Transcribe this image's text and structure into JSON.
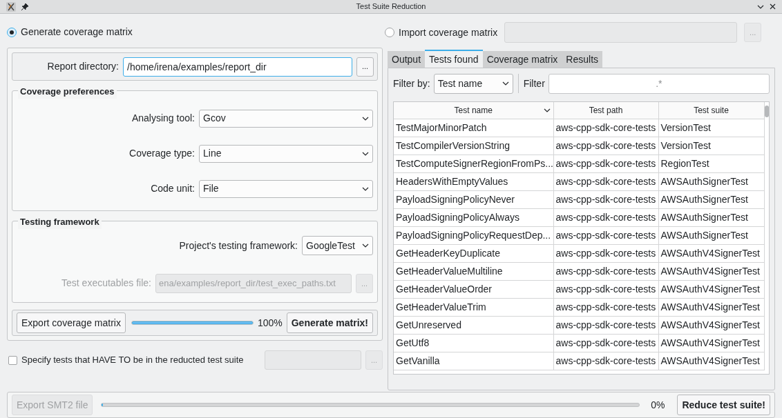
{
  "window": {
    "title": "Test Suite Reduction"
  },
  "source_options": [
    {
      "label": "Generate coverage matrix",
      "selected": true
    },
    {
      "label": "Import coverage matrix",
      "selected": false
    }
  ],
  "import_path": {
    "disabled": true,
    "browse": "..."
  },
  "report_directory": {
    "label": "Report directory:",
    "value": "/home/irena/examples/report_dir",
    "browse": "..."
  },
  "coverage_preferences": {
    "title": "Coverage preferences",
    "fields": [
      {
        "label": "Analysing tool:",
        "value": "Gcov"
      },
      {
        "label": "Coverage type:",
        "value": "Line"
      },
      {
        "label": "Code unit:",
        "value": "File"
      }
    ]
  },
  "testing_framework": {
    "title": "Testing framework",
    "framework": {
      "label": "Project's testing framework:",
      "value": "GoogleTest"
    },
    "executables": {
      "label": "Test executables file:",
      "value": "ena/examples/report_dir/test_exec_paths.txt",
      "browse": "...",
      "disabled": true
    }
  },
  "matrix_bar": {
    "export": "Export coverage matrix",
    "level": 1,
    "reading": "100%",
    "generate": "Generate matrix!"
  },
  "required_tests": {
    "label": "Specify tests that HAVE TO be in the reducted test suite",
    "checked": false,
    "browse": "..."
  },
  "tabs": [
    {
      "label": "Output",
      "selected": false
    },
    {
      "label": "Tests found",
      "selected": true
    },
    {
      "label": "Coverage matrix",
      "selected": false
    },
    {
      "label": "Results",
      "selected": false
    }
  ],
  "filter": {
    "by_label": "Filter by:",
    "by_value": "Test name",
    "label": "Filter",
    "placeholder": ".*"
  },
  "table": {
    "columns": [
      "Test name",
      "Test path",
      "Test suite"
    ],
    "rows": [
      [
        "TestMajorMinorPatch",
        "aws-cpp-sdk-core-tests",
        "VersionTest"
      ],
      [
        "TestCompilerVersionString",
        "aws-cpp-sdk-core-tests",
        "VersionTest"
      ],
      [
        "TestComputeSignerRegionFromPs...",
        "aws-cpp-sdk-core-tests",
        "RegionTest"
      ],
      [
        "HeadersWithEmptyValues",
        "aws-cpp-sdk-core-tests",
        "AWSAuthSignerTest"
      ],
      [
        "PayloadSigningPolicyNever",
        "aws-cpp-sdk-core-tests",
        "AWSAuthSignerTest"
      ],
      [
        "PayloadSigningPolicyAlways",
        "aws-cpp-sdk-core-tests",
        "AWSAuthSignerTest"
      ],
      [
        "PayloadSigningPolicyRequestDep...",
        "aws-cpp-sdk-core-tests",
        "AWSAuthSignerTest"
      ],
      [
        "GetHeaderKeyDuplicate",
        "aws-cpp-sdk-core-tests",
        "AWSAuthV4SignerTest"
      ],
      [
        "GetHeaderValueMultiline",
        "aws-cpp-sdk-core-tests",
        "AWSAuthV4SignerTest"
      ],
      [
        "GetHeaderValueOrder",
        "aws-cpp-sdk-core-tests",
        "AWSAuthV4SignerTest"
      ],
      [
        "GetHeaderValueTrim",
        "aws-cpp-sdk-core-tests",
        "AWSAuthV4SignerTest"
      ],
      [
        "GetUnreserved",
        "aws-cpp-sdk-core-tests",
        "AWSAuthV4SignerTest"
      ],
      [
        "GetUtf8",
        "aws-cpp-sdk-core-tests",
        "AWSAuthV4SignerTest"
      ],
      [
        "GetVanilla",
        "aws-cpp-sdk-core-tests",
        "AWSAuthV4SignerTest"
      ]
    ]
  },
  "reduce_bar": {
    "export": "Export SMT2 file",
    "export_disabled": true,
    "level": 0,
    "reading": "0%",
    "reduce": "Reduce test suite!"
  }
}
